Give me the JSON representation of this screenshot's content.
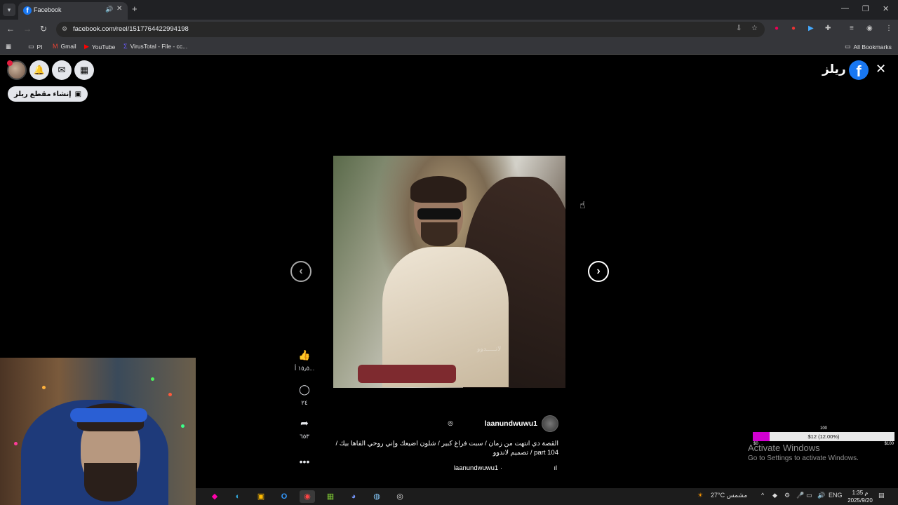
{
  "browser": {
    "tab": {
      "title": "Facebook",
      "favicon": "facebook-icon"
    },
    "new_tab": "+",
    "window_controls": {
      "minimize": "—",
      "restore": "❐",
      "close": "✕"
    },
    "url": "facebook.com/reel/1517764422994198",
    "bookmarks": [
      {
        "label": "PI",
        "icon": "folder-icon"
      },
      {
        "label": "Gmail",
        "icon": "gmail-icon"
      },
      {
        "label": "YouTube",
        "icon": "youtube-icon"
      },
      {
        "label": "VirusTotal - File - cc...",
        "icon": "virustotal-icon"
      }
    ],
    "all_bookmarks": "All Bookmarks"
  },
  "reels": {
    "title": "ريلز",
    "create_reel": "إنشاء مقطع ريلز",
    "actions": {
      "likes": "١٥٫٥ أ...",
      "comments": "٢٤",
      "shares": "٦٥٣"
    },
    "author": "laanundwuwu1",
    "caption": "القصة دي انتهت من زمان / سبت فراغ كبير / شلون اضيعك وإني روحي الفاها بيك / part 104 / تصميم لاندوو",
    "audio": "laanundwuwu1 ·",
    "watermark": "لانـــــدوو"
  },
  "donation": {
    "goal_label": "100",
    "bar_text": "$12 (12.00%)",
    "progress_fraction": 0.12,
    "min": "$0",
    "max": "$100",
    "fill_color": "#d100d1"
  },
  "windows_watermark": {
    "line1": "Activate Windows",
    "line2": "Go to Settings to activate Windows."
  },
  "taskbar": {
    "weather": "27°C مشمس",
    "language": "ENG",
    "time": "1:35 م",
    "date": "2025/9/20"
  }
}
